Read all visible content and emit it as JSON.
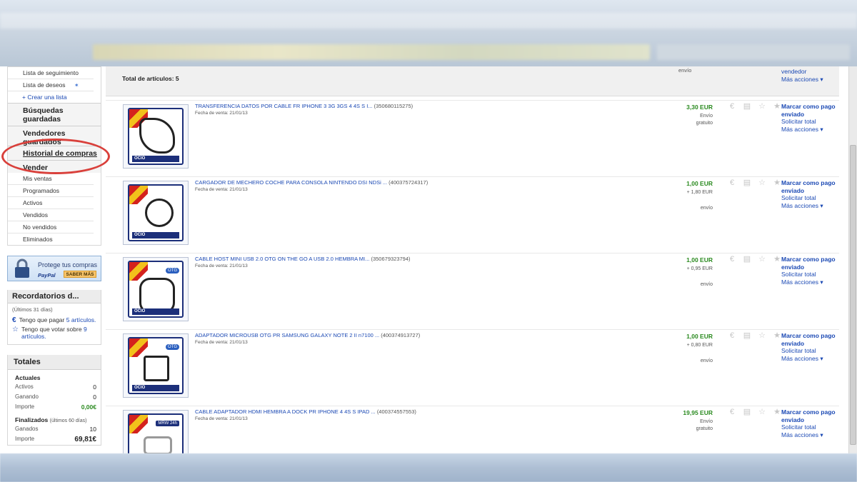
{
  "sidebar": {
    "top_links": [
      "Lista de seguimiento",
      "Lista de deseos",
      "Crear una lista"
    ],
    "busquedas": "Búsquedas guardadas",
    "vendedores": "Vendedores guardados",
    "historial": "Historial de compras",
    "vender": "Vender",
    "vender_links": [
      "Mis ventas",
      "Programados",
      "Activos",
      "Vendidos",
      "No vendidos",
      "Eliminados"
    ],
    "promo_text": "Protege tus compras",
    "promo_paypal": "PayPal",
    "promo_button": "SABER MÁS",
    "recordatorios_title": "Recordatorios d...",
    "recordatorios_period": "(Últimos 31 días)",
    "reminder_pay_prefix": "Tengo que pagar",
    "reminder_pay_link": "5 artículos.",
    "reminder_vote_prefix": "Tengo que votar sobre",
    "reminder_vote_link": "9 artículos.",
    "totales_title": "Totales",
    "actuales_label": "Actuales",
    "actuales": [
      {
        "k": "Activos",
        "v": "0"
      },
      {
        "k": "Ganando",
        "v": "0"
      },
      {
        "k": "Importe",
        "v": "0,00€"
      }
    ],
    "finalizados_label": "Finalizados",
    "finalizados_period": "(últimos 60 días)",
    "finalizados": [
      {
        "k": "Ganados",
        "v": "10"
      },
      {
        "k": "Importe",
        "v": "69,81€"
      }
    ]
  },
  "main": {
    "total_label": "Total de artículos: 5",
    "top_envio": "envío",
    "top_action1": "vendedor",
    "top_action2": "Más acciones ▾",
    "items": [
      {
        "title": "TRANSFERENCIA DATOS POR CABLE FR IPHONE 3 3G 3GS 4 4S S I...",
        "id": "(350680115275)",
        "date": "Fecha de venta: 21/01/13",
        "price": "3,30 EUR",
        "ship_line1": "Envío",
        "ship_line2": "gratuito",
        "ship_line3": "",
        "mark": "Marcar como pago enviado",
        "total": "Solicitar total",
        "more": "Más acciones ▾"
      },
      {
        "title": "CARGADOR DE MECHERO COCHE PARA CONSOLA NINTENDO DSI NDSi ...",
        "id": "(400375724317)",
        "date": "Fecha de venta: 21/01/13",
        "price": "1,00 EUR",
        "ship_line1": "+ 1,80 EUR",
        "ship_line2": "",
        "ship_line3": "envío",
        "mark": "Marcar como pago enviado",
        "total": "Solicitar total",
        "more": "Más acciones ▾"
      },
      {
        "title": "CABLE HOST MINI USB 2.0 OTG ON THE GO A USB 2.0 HEMBRA MI...",
        "id": "(350679323794)",
        "date": "Fecha de venta: 21/01/13",
        "price": "1,00 EUR",
        "ship_line1": "+ 0,95 EUR",
        "ship_line2": "",
        "ship_line3": "envío",
        "mark": "Marcar como pago enviado",
        "total": "Solicitar total",
        "more": "Más acciones ▾",
        "badge": "OTG"
      },
      {
        "title": "ADAPTADOR MICROUSB OTG PR SAMSUNG GALAXY NOTE 2 II n7100 ...",
        "id": "(400374913727)",
        "date": "Fecha de venta: 21/01/13",
        "price": "1,00 EUR",
        "ship_line1": "+ 0,80 EUR",
        "ship_line2": "",
        "ship_line3": "envío",
        "mark": "Marcar como pago enviado",
        "total": "Solicitar total",
        "more": "Más acciones ▾",
        "badge": "OTG"
      },
      {
        "title": "CABLE ADAPTADOR HDMI HEMBRA A DOCK PR IPHONE 4 4S S IPAD ...",
        "id": "(400374557553)",
        "date": "Fecha de venta: 21/01/13",
        "price": "19,95 EUR",
        "ship_line1": "Envío",
        "ship_line2": "gratuito",
        "ship_line3": "",
        "mark": "Marcar como pago enviado",
        "total": "Solicitar total",
        "more": "Más acciones ▾",
        "badge": "MRW 24h"
      }
    ]
  },
  "colors": {
    "link": "#1b49b4",
    "price_green": "#2a8a1f",
    "annotation_red": "#d9403b"
  }
}
